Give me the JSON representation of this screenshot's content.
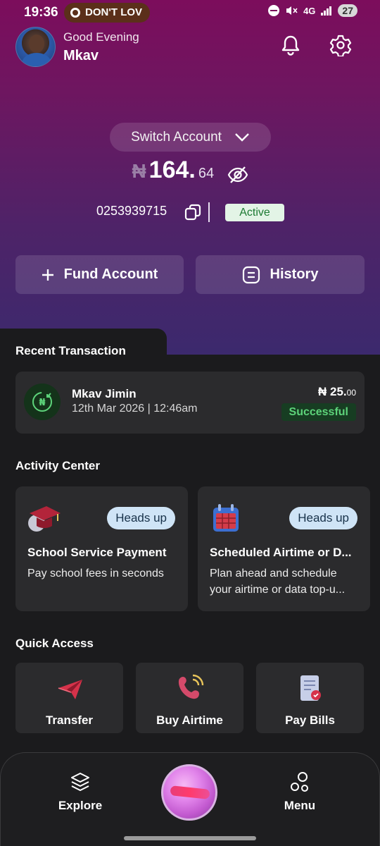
{
  "status_bar": {
    "time": "19:36",
    "notification": "DON'T LOV",
    "network": "4G",
    "battery": "27"
  },
  "header": {
    "greeting": "Good Evening",
    "username": "Mkav"
  },
  "account": {
    "switch_label": "Switch Account",
    "currency": "₦",
    "balance_whole": "164.",
    "balance_decimal": "64",
    "number": "0253939715",
    "status": "Active"
  },
  "actions": {
    "fund_label": "Fund Account",
    "history_label": "History"
  },
  "recent": {
    "title": "Recent Transaction",
    "name": "Mkav Jimin",
    "date": "12th Mar 2026 | 12:46am",
    "amount_main": "₦ 25.",
    "amount_decimal": "00",
    "status": "Successful"
  },
  "activity": {
    "title": "Activity Center",
    "cards": [
      {
        "badge": "Heads up",
        "title": "School Service Payment",
        "desc": "Pay school fees in seconds",
        "icon": "graduation-cap-icon"
      },
      {
        "badge": "Heads up",
        "title": "Scheduled Airtime or D...",
        "desc": "Plan ahead and schedule your airtime or data top-u...",
        "icon": "calendar-icon"
      }
    ]
  },
  "quick_access": {
    "title": "Quick Access",
    "items": [
      {
        "label": "Transfer",
        "icon": "paper-plane-icon"
      },
      {
        "label": "Buy Airtime",
        "icon": "phone-icon"
      },
      {
        "label": "Pay Bills",
        "icon": "bill-icon"
      }
    ]
  },
  "bottom_nav": {
    "explore": "Explore",
    "menu": "Menu"
  },
  "colors": {
    "brand": "#7c0d5c",
    "success": "#5dd37a",
    "panel": "#1b1b1d",
    "card": "#2b2b2d"
  }
}
